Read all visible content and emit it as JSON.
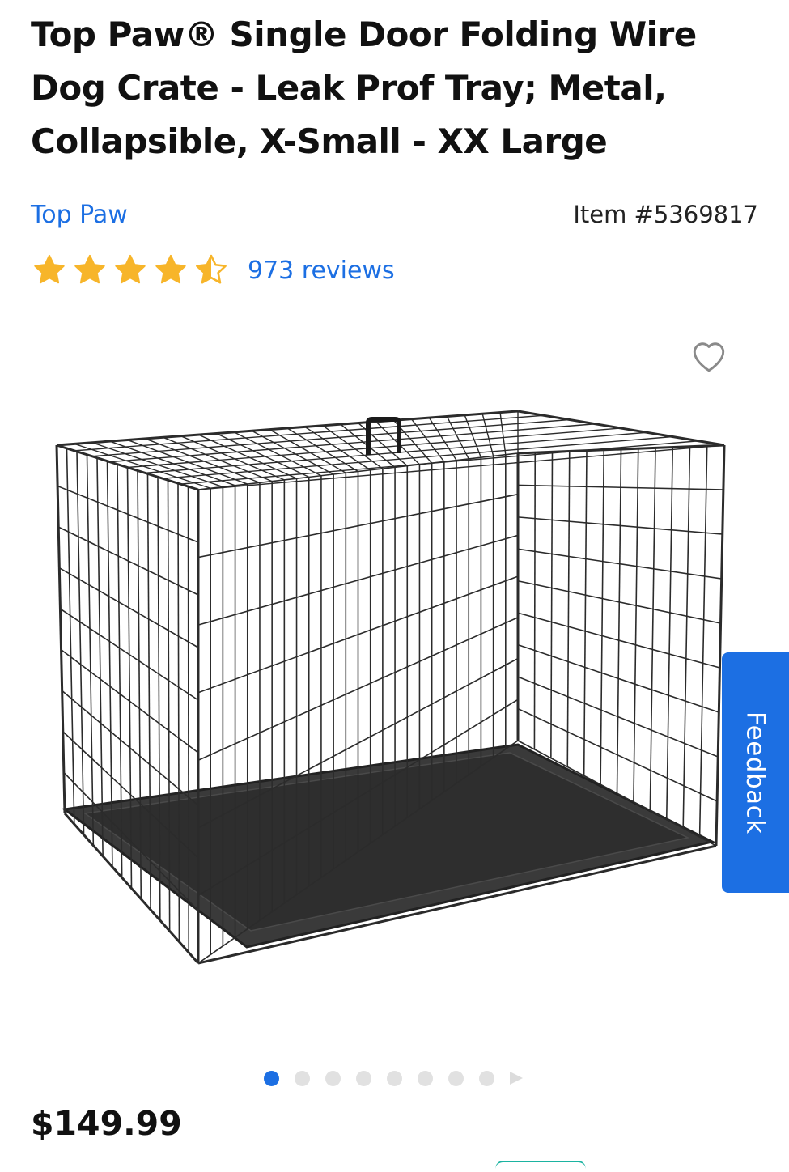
{
  "product": {
    "title": "Top Paw® Single Door Folding Wire Dog Crate - Leak Prof Tray; Metal, Collapsible, X-Small - XX Large",
    "brand": "Top Paw",
    "item_number": "Item #5369817",
    "rating": 4.5,
    "rating_max": 5,
    "reviews_label": "973 reviews",
    "price": "$149.99"
  },
  "feedback": {
    "label": "Feedback"
  },
  "carousel": {
    "total": 8,
    "active_index": 0
  },
  "colors": {
    "accent": "#1c6fe3",
    "star": "#f7b52a",
    "favorite_outline": "#8a8a8a",
    "crate_wire": "#2b2b2b",
    "tray": "#3a3a3a"
  },
  "icons": {
    "favorite": "heart-outline-icon",
    "star": "star-icon",
    "next": "chevron-right-icon"
  }
}
